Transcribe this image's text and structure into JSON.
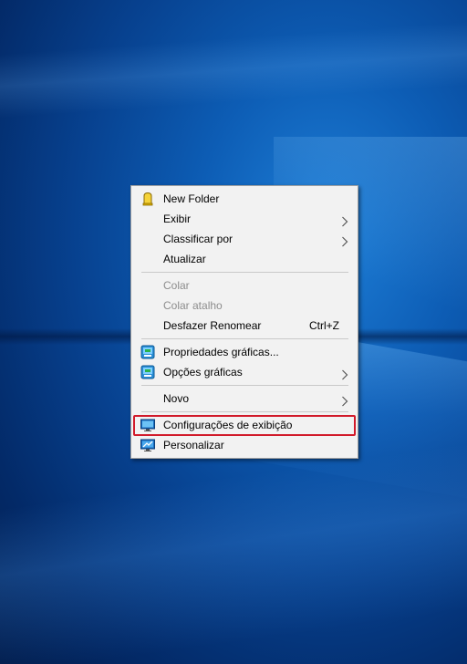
{
  "desktop": {
    "accent": "#0a56b0"
  },
  "context_menu": {
    "items": [
      {
        "label": "New Folder",
        "icon": "folder-yellow-icon",
        "submenu": false,
        "disabled": false
      },
      {
        "label": "Exibir",
        "submenu": true,
        "disabled": false
      },
      {
        "label": "Classificar por",
        "submenu": true,
        "disabled": false
      },
      {
        "label": "Atualizar",
        "submenu": false,
        "disabled": false
      },
      {
        "label": "Colar",
        "submenu": false,
        "disabled": true
      },
      {
        "label": "Colar atalho",
        "submenu": false,
        "disabled": true
      },
      {
        "label": "Desfazer Renomear",
        "shortcut": "Ctrl+Z",
        "submenu": false,
        "disabled": false
      },
      {
        "label": "Propriedades gráficas...",
        "icon": "graphics-properties-icon",
        "submenu": false,
        "disabled": false
      },
      {
        "label": "Opções gráficas",
        "icon": "graphics-options-icon",
        "submenu": true,
        "disabled": false
      },
      {
        "label": "Novo",
        "submenu": true,
        "disabled": false
      },
      {
        "label": "Configurações de exibição",
        "icon": "display-settings-icon",
        "submenu": false,
        "disabled": false,
        "highlighted": true
      },
      {
        "label": "Personalizar",
        "icon": "personalize-icon",
        "submenu": false,
        "disabled": false
      }
    ],
    "highlight_color": "#d11a2a"
  }
}
